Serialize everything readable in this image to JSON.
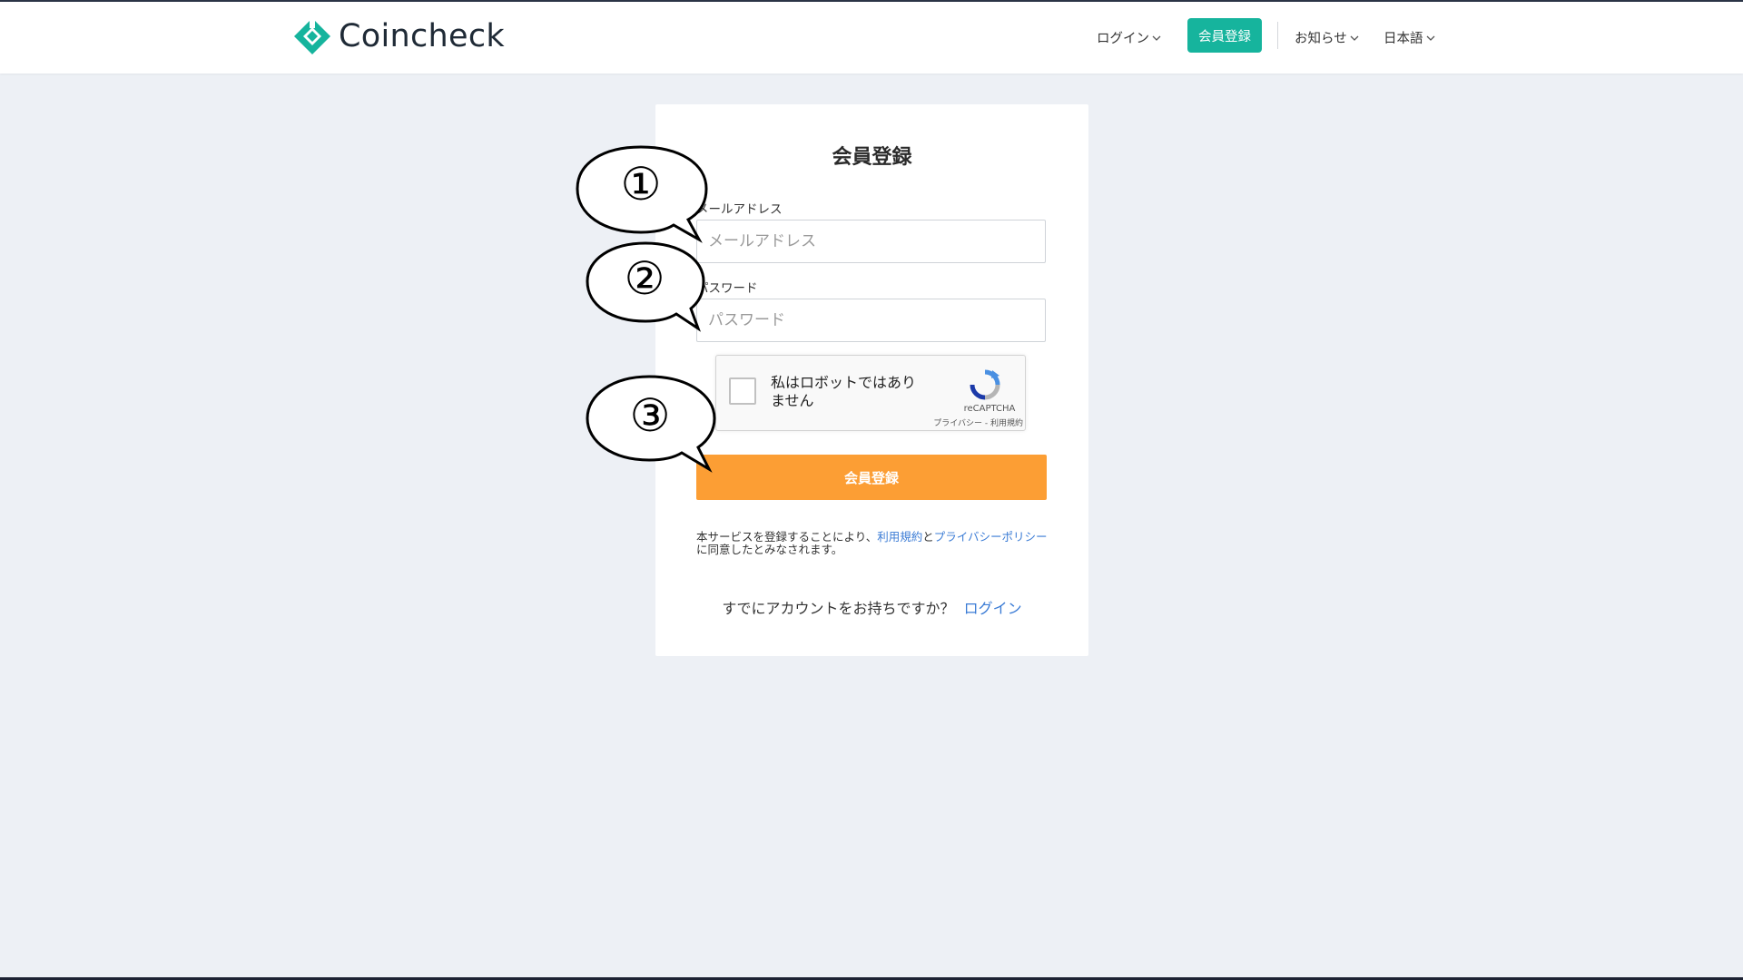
{
  "brand": {
    "name": "Coincheck",
    "accent": "#16b49d"
  },
  "header": {
    "login": "ログイン",
    "signup": "会員登録",
    "news": "お知らせ",
    "language": "日本語"
  },
  "form": {
    "title": "会員登録",
    "email_label": "メールアドレス",
    "email_placeholder": "メールアドレス",
    "password_label": "パスワード",
    "password_placeholder": "パスワード",
    "captcha": {
      "text": "私はロボットではありません",
      "brand": "reCAPTCHA",
      "links": "プライバシー - 利用規約"
    },
    "submit": "会員登録",
    "terms": {
      "prefix": "本サービスを登録することにより、",
      "terms_link": "利用規約",
      "and": "と",
      "privacy_link": "プライバシーポリシー",
      "suffix": "に同意したとみなされます。"
    },
    "login_prompt": "すでにアカウントをお持ちですか？",
    "login_link": "ログイン"
  },
  "annotations": [
    "①",
    "②",
    "③"
  ],
  "colors": {
    "submit": "#fc9e34",
    "link": "#3a7bd5",
    "background": "#edf0f5"
  }
}
